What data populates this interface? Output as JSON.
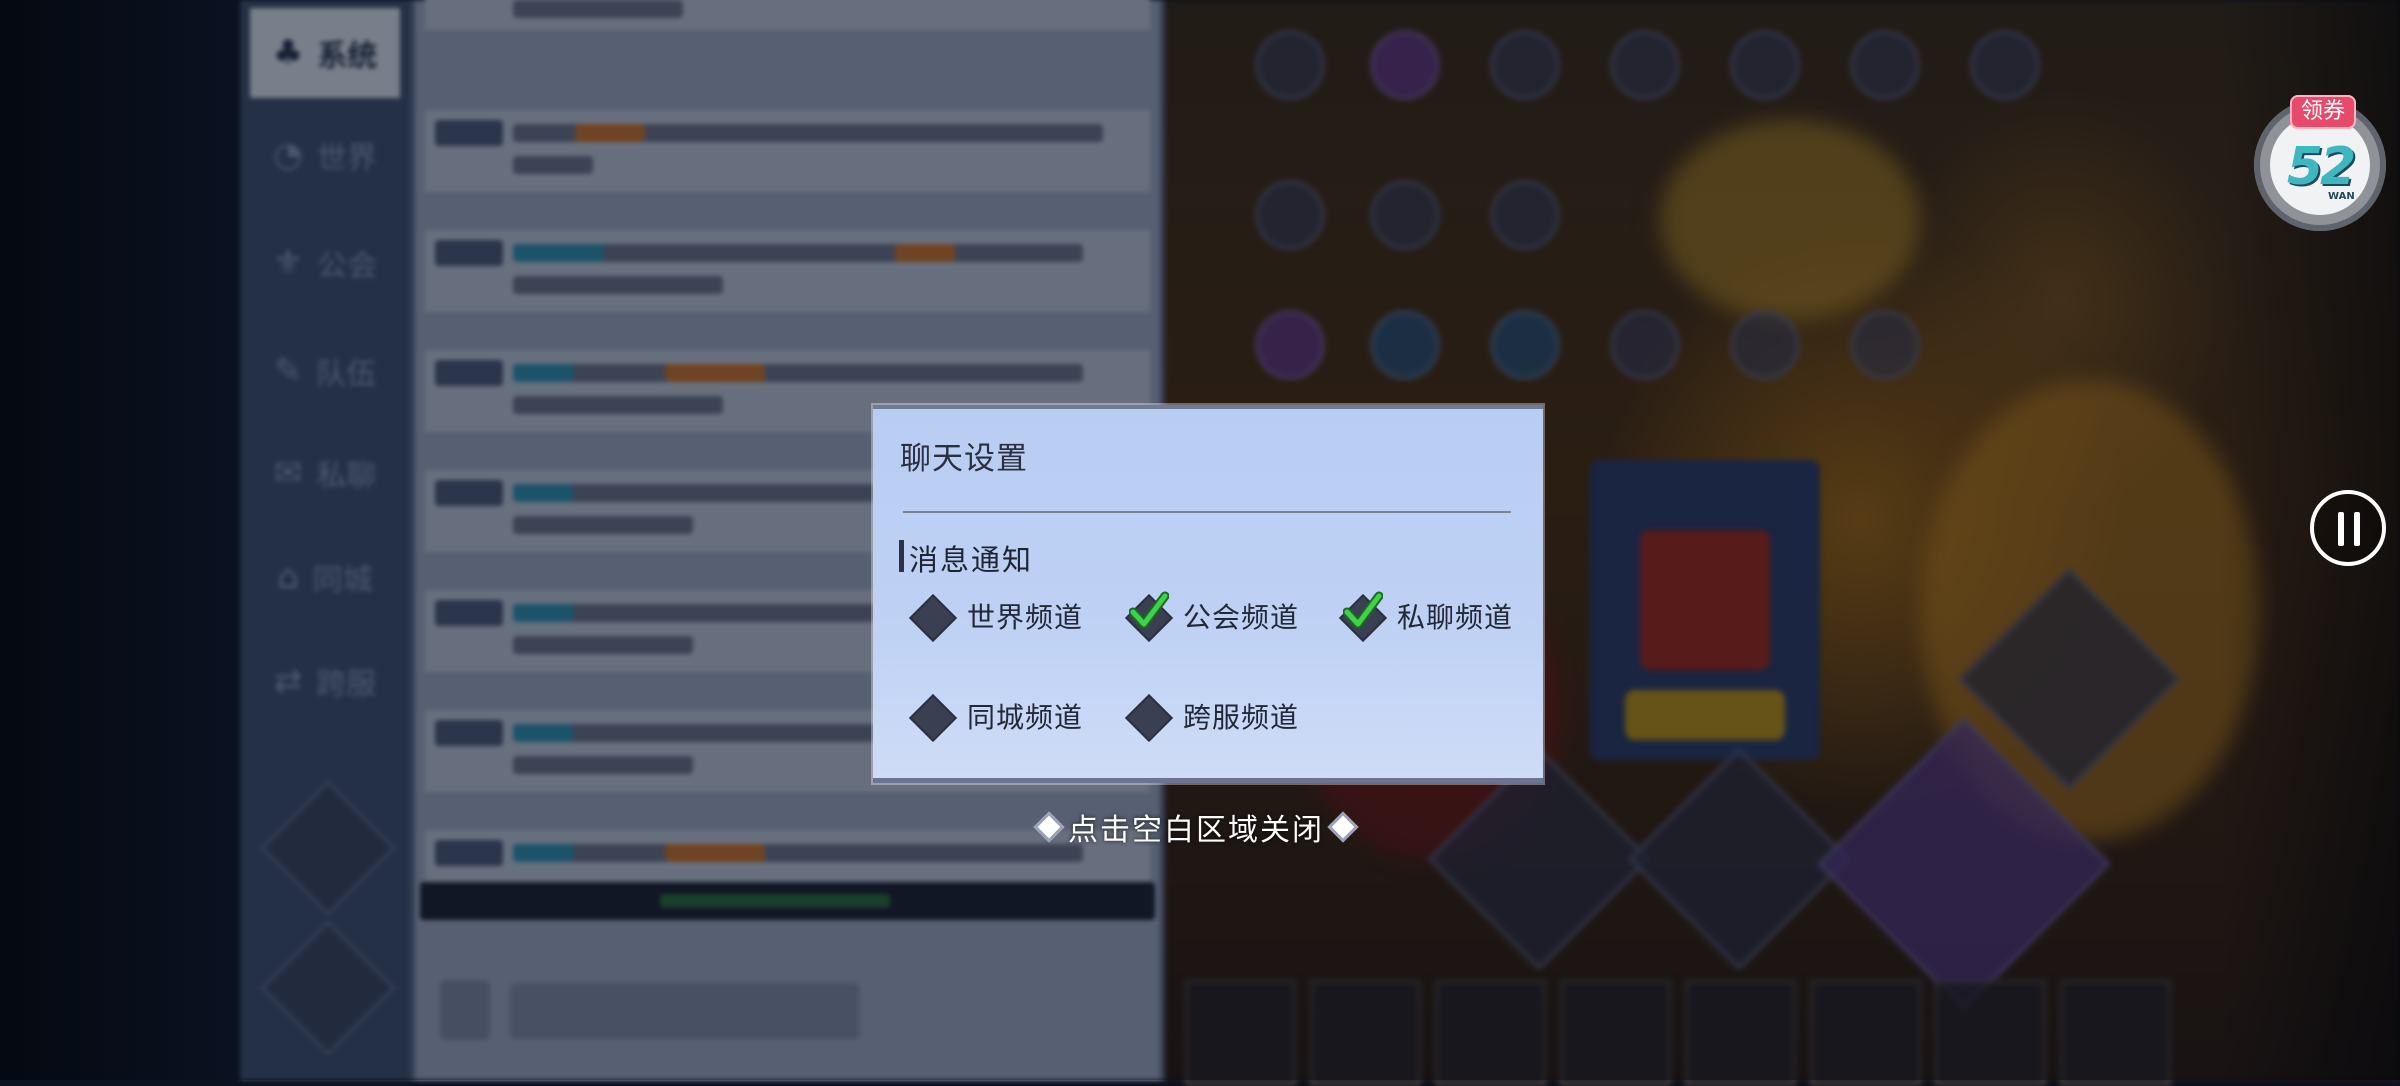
{
  "chat_panel": {
    "active_tab": "系统",
    "tabs": [
      {
        "icon": "system-icon",
        "label": "系统"
      },
      {
        "icon": "world-icon",
        "label": "世界"
      },
      {
        "icon": "guild-icon",
        "label": "公会"
      },
      {
        "icon": "team-icon",
        "label": "队伍"
      },
      {
        "icon": "private-icon",
        "label": "私聊"
      },
      {
        "icon": "city-icon",
        "label": "同城"
      },
      {
        "icon": "cross-server-icon",
        "label": "跨服"
      }
    ]
  },
  "modal": {
    "title": "聊天设置",
    "section_label": "消息通知",
    "options": [
      {
        "label": "世界频道",
        "checked": false
      },
      {
        "label": "公会频道",
        "checked": true
      },
      {
        "label": "私聊频道",
        "checked": true
      },
      {
        "label": "同城频道",
        "checked": false
      },
      {
        "label": "跨服频道",
        "checked": false
      }
    ]
  },
  "close_hint": "点击空白区域关闭",
  "coupon_widget": {
    "badge": "领券",
    "number": "52",
    "sub": "WAN"
  },
  "colors": {
    "modal_bg": "#bed1f4",
    "check_green": "#3fd24a",
    "coupon_badge": "#e64b6c"
  }
}
